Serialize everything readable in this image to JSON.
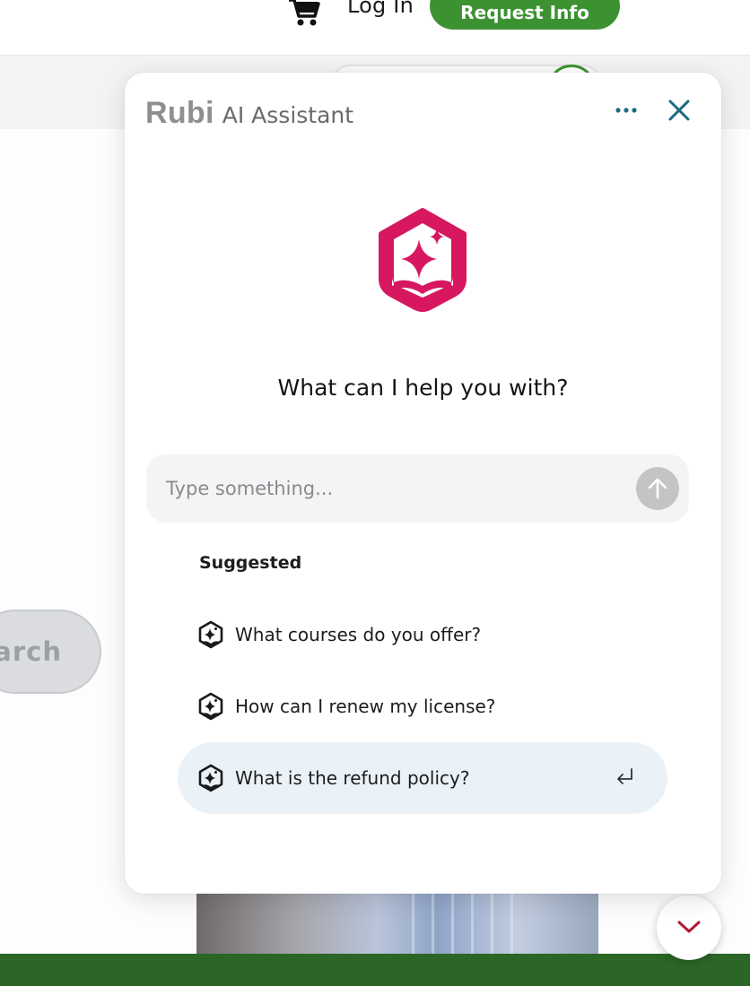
{
  "header": {
    "login_label": "Log In",
    "request_label": "Request Info"
  },
  "background": {
    "search_label": "earch"
  },
  "assistant": {
    "brand_name": "Rubi",
    "brand_suffix": "AI Assistant",
    "headline": "What can I help you with?",
    "input_placeholder": "Type something...",
    "suggested_heading": "Suggested",
    "suggestions": [
      {
        "label": "What courses do you offer?"
      },
      {
        "label": "How can I renew my license?"
      },
      {
        "label": "What is the refund policy?"
      }
    ]
  },
  "colors": {
    "brand_green": "#3c9231",
    "footer_green": "#2b6626",
    "logo_pink": "#d7175f",
    "icon_teal": "#1c6b7e",
    "highlight": "#eaf2f8"
  },
  "icons": {
    "cart": "cart-icon",
    "more": "more-horizontal-icon",
    "close": "close-icon",
    "send": "arrow-up-icon",
    "suggestion": "sparkle-badge-icon",
    "enter": "enter-return-icon",
    "scroll": "chevron-down-icon"
  }
}
